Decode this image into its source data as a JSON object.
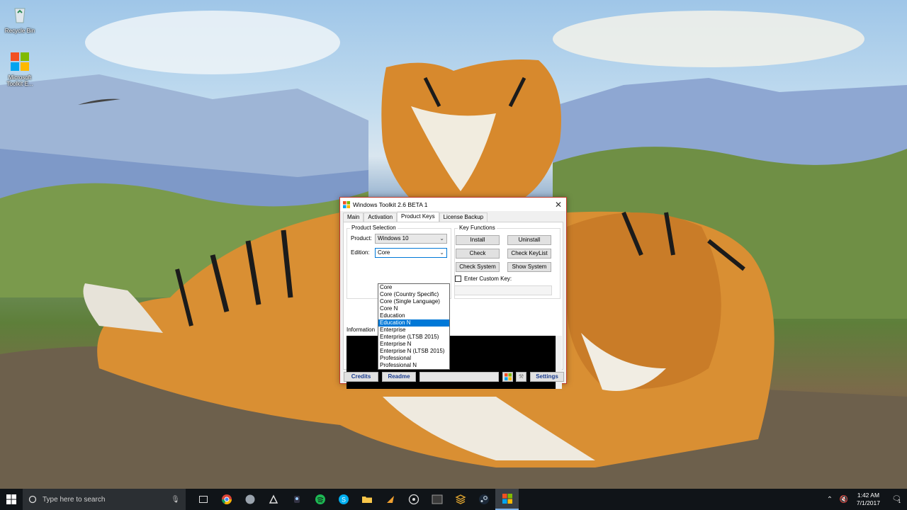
{
  "desktop": {
    "icons": [
      {
        "label": "Recycle Bin",
        "icon": "recycle-bin-icon"
      },
      {
        "label": "Microsoft Toolkit E...",
        "icon": "microsoft-toolkit-icon"
      }
    ]
  },
  "window": {
    "title": "Windows Toolkit 2.6 BETA 1",
    "close_glyph": "✕",
    "tabs": [
      {
        "label": "Main"
      },
      {
        "label": "Activation"
      },
      {
        "label": "Product Keys"
      },
      {
        "label": "License Backup"
      }
    ],
    "active_tab": "Product Keys",
    "product_selection": {
      "legend": "Product Selection",
      "product_label": "Product:",
      "product_value": "Windows 10",
      "edition_label": "Edition:",
      "edition_value": "Core"
    },
    "edition_options": [
      "Core",
      "Core (Country Specific)",
      "Core (Single Language)",
      "Core N",
      "Education",
      "Education N",
      "Enterprise",
      "Enterprise (LTSB 2015)",
      "Enterprise N",
      "Enterprise N (LTSB 2015)",
      "Professional",
      "Professional N"
    ],
    "highlighted_option": "Education N",
    "key_functions": {
      "legend": "Key Functions",
      "install": "Install",
      "uninstall": "Uninstall",
      "check": "Check",
      "check_keylist": "Check KeyList",
      "check_system": "Check System",
      "show_system": "Show System",
      "enter_custom_key": "Enter Custom Key:"
    },
    "information_label": "Information",
    "bottom": {
      "credits": "Credits",
      "readme": "Readme",
      "settings": "Settings"
    }
  },
  "taskbar": {
    "search_placeholder": "Type here to search",
    "apps": [
      "task-view-icon",
      "chrome-icon",
      "app-icon",
      "app-icon",
      "app-icon",
      "spotify-icon",
      "skype-icon",
      "file-explorer-icon",
      "app-icon",
      "app-icon",
      "live-icon",
      "app-icon",
      "steam-icon",
      "windows-toolkit-icon"
    ],
    "time": "1:42 AM",
    "date": "7/1/2017",
    "notification_count": "1"
  },
  "colors": {
    "accent": "#0078d7",
    "window_border": "#c0392b",
    "taskbar_bg": "#101418",
    "button_text": "#1a3c8e"
  }
}
